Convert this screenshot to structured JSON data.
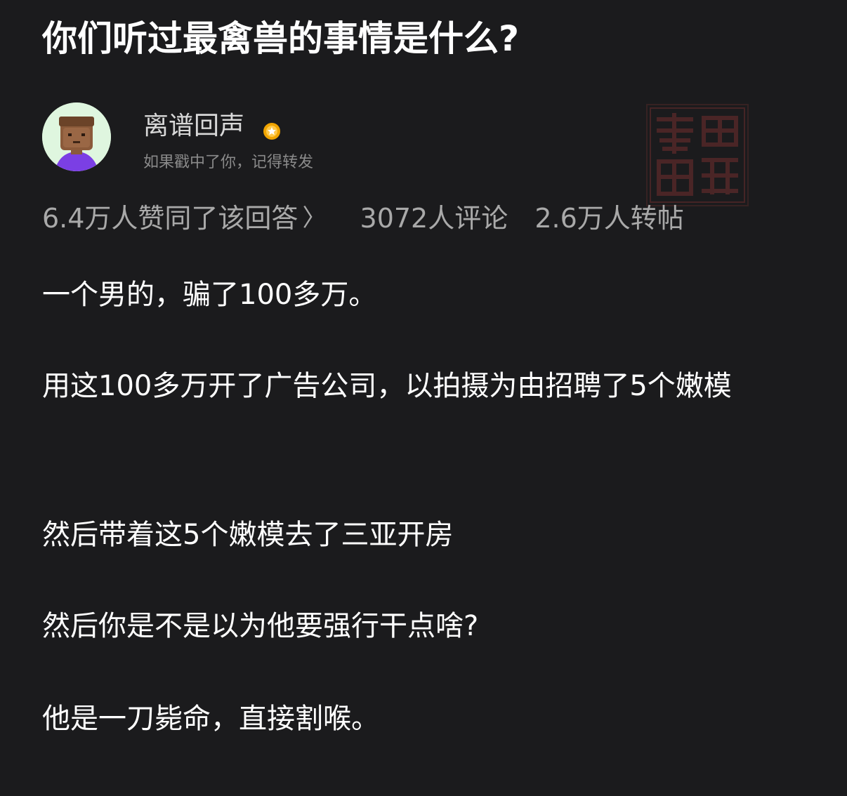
{
  "question": {
    "title": "你们听过最禽兽的事情是什么?"
  },
  "author": {
    "name": "离谱回声",
    "bio": "如果戳中了你，记得转发",
    "avatar_icon": "person-avatar-icon",
    "badge_icon": "gold-badge-icon",
    "badge_color": "#f0a400"
  },
  "watermark": {
    "icon": "seal-stamp-icon"
  },
  "stats": {
    "upvotes": "6.4万人赞同了该回答",
    "upvotes_chevron": "〉",
    "comments": "3072人评论",
    "reposts": "2.6万人转帖"
  },
  "answer": {
    "paragraphs": [
      "一个男的，骗了100多万。",
      "用这100多万开了广告公司，以拍摄为由招聘了5个嫩模",
      "然后带着这5个嫩模去了三亚开房",
      "然后你是不是以为他要强行干点啥?",
      "他是一刀毙命，直接割喉。"
    ]
  },
  "colors": {
    "background": "#1b1b1d",
    "title_text": "#ffffff",
    "body_text": "#ffffff",
    "secondary_text": "#a9a9a9",
    "bio_text": "#8a8a8a",
    "stamp": "#5a2a2a"
  }
}
